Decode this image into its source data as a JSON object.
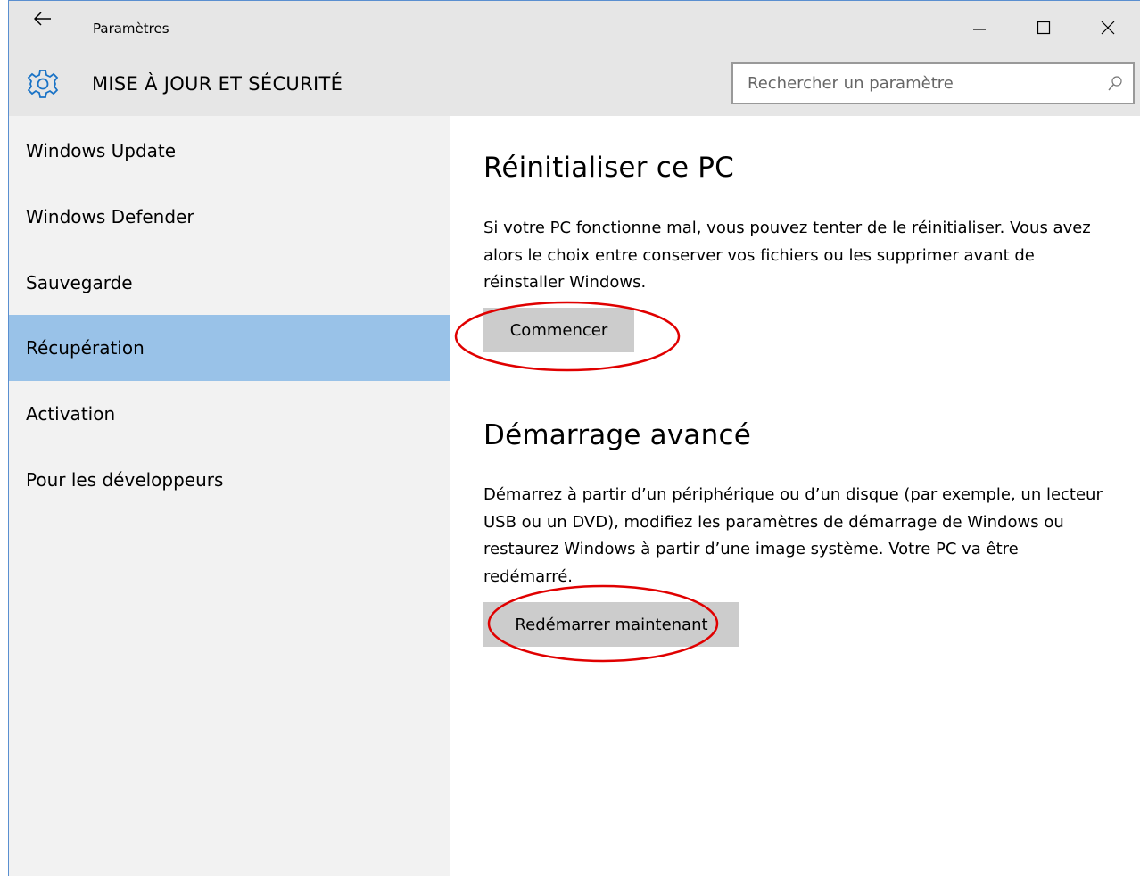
{
  "titlebar": {
    "app_title": "Paramètres",
    "back_icon": "arrow-left-icon",
    "minimize_icon": "minimize-icon",
    "maximize_icon": "maximize-icon",
    "close_icon": "close-icon"
  },
  "header": {
    "section_icon": "gear-icon",
    "section_title": "MISE À JOUR ET SÉCURITÉ",
    "search": {
      "placeholder": "Rechercher un paramètre",
      "value": "",
      "icon": "search-icon"
    }
  },
  "sidebar": {
    "items": [
      {
        "label": "Windows Update",
        "active": false
      },
      {
        "label": "Windows Defender",
        "active": false
      },
      {
        "label": "Sauvegarde",
        "active": false
      },
      {
        "label": "Récupération",
        "active": true
      },
      {
        "label": "Activation",
        "active": false
      },
      {
        "label": "Pour les développeurs",
        "active": false
      }
    ]
  },
  "main": {
    "reset": {
      "title": "Réinitialiser ce PC",
      "description": "Si votre PC fonctionne mal, vous pouvez tenter de le réinitialiser. Vous avez alors le choix entre conserver vos fichiers ou les supprimer avant de réinstaller Windows.",
      "button_label": "Commencer"
    },
    "advanced": {
      "title": "Démarrage avancé",
      "description": "Démarrez à partir d’un périphérique ou d’un disque (par exemple, un lecteur USB ou un DVD), modifiez les paramètres de démarrage de Windows ou restaurez Windows à partir d’une image système. Votre PC va être redémarré.",
      "button_label": "Redémarrer maintenant"
    }
  },
  "colors": {
    "header_bg": "#e6e6e6",
    "sidebar_bg": "#f2f2f2",
    "active_item_bg": "#99c2e8",
    "button_bg": "#cccccc",
    "accent_icon": "#1a73c6",
    "annotation": "#e00000"
  }
}
